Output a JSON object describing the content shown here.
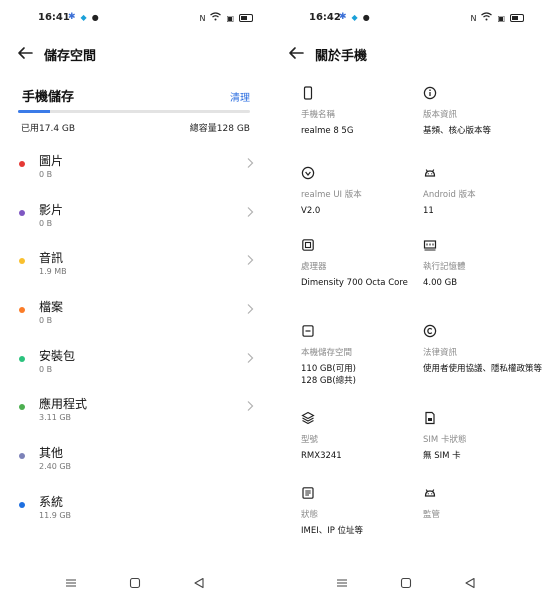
{
  "left_panel": {
    "status": {
      "time": "16:41"
    },
    "header": {
      "title": "儲存空間"
    },
    "storage": {
      "heading": "手機儲存",
      "clean_label": "清理",
      "used_label": "已用17.4 GB",
      "total_label": "總容量128 GB",
      "used_fraction": 0.136,
      "accent_color": "#3b7be8"
    },
    "categories": [
      {
        "name": "圖片",
        "size": "0 B",
        "color": "#e53935",
        "has_chevron": true
      },
      {
        "name": "影片",
        "size": "0 B",
        "color": "#7e57c2",
        "has_chevron": true
      },
      {
        "name": "音訊",
        "size": "1.9 MB",
        "color": "#f9c02e",
        "has_chevron": true
      },
      {
        "name": "檔案",
        "size": "0 B",
        "color": "#fb7c28",
        "has_chevron": true
      },
      {
        "name": "安裝包",
        "size": "0 B",
        "color": "#2bc27d",
        "has_chevron": true
      },
      {
        "name": "應用程式",
        "size": "3.11  GB",
        "color": "#4caf50",
        "has_chevron": true
      },
      {
        "name": "其他",
        "size": "2.40 GB",
        "color": "#7c82b8",
        "has_chevron": false
      },
      {
        "name": "系統",
        "size": "11.9 GB",
        "color": "#1e6fe0",
        "has_chevron": false
      }
    ]
  },
  "right_panel": {
    "status": {
      "time": "16:42"
    },
    "header": {
      "title": "關於手機"
    },
    "items": [
      {
        "icon": "phone-icon",
        "label": "手機名稱",
        "value": "realme 8 5G"
      },
      {
        "icon": "info-icon",
        "label": "版本資訊",
        "value": "基頻、核心版本等"
      },
      {
        "icon": "check-circle-icon",
        "label": "realme UI 版本",
        "value": "V2.0"
      },
      {
        "icon": "android-icon",
        "label": "Android 版本",
        "value": "11"
      },
      {
        "icon": "processor-icon",
        "label": "處理器",
        "value": "Dimensity 700 Octa Core"
      },
      {
        "icon": "ram-icon",
        "label": "執行記憶體",
        "value": "4.00 GB"
      },
      {
        "icon": "storage-icon",
        "label": "本機儲存空間",
        "value": "110 GB(可用)\n128 GB(總共)"
      },
      {
        "icon": "copyright-icon",
        "label": "法律資訊",
        "value": "使用者使用協議、隱私權政策等"
      },
      {
        "icon": "layers-icon",
        "label": "型號",
        "value": "RMX3241"
      },
      {
        "icon": "sim-card-icon",
        "label": "SIM 卡狀態",
        "value": "無 SIM 卡"
      },
      {
        "icon": "list-icon",
        "label": "狀態",
        "value": "IMEI、IP 位址等"
      },
      {
        "icon": "android-icon",
        "label": "監管",
        "value": ""
      }
    ]
  }
}
